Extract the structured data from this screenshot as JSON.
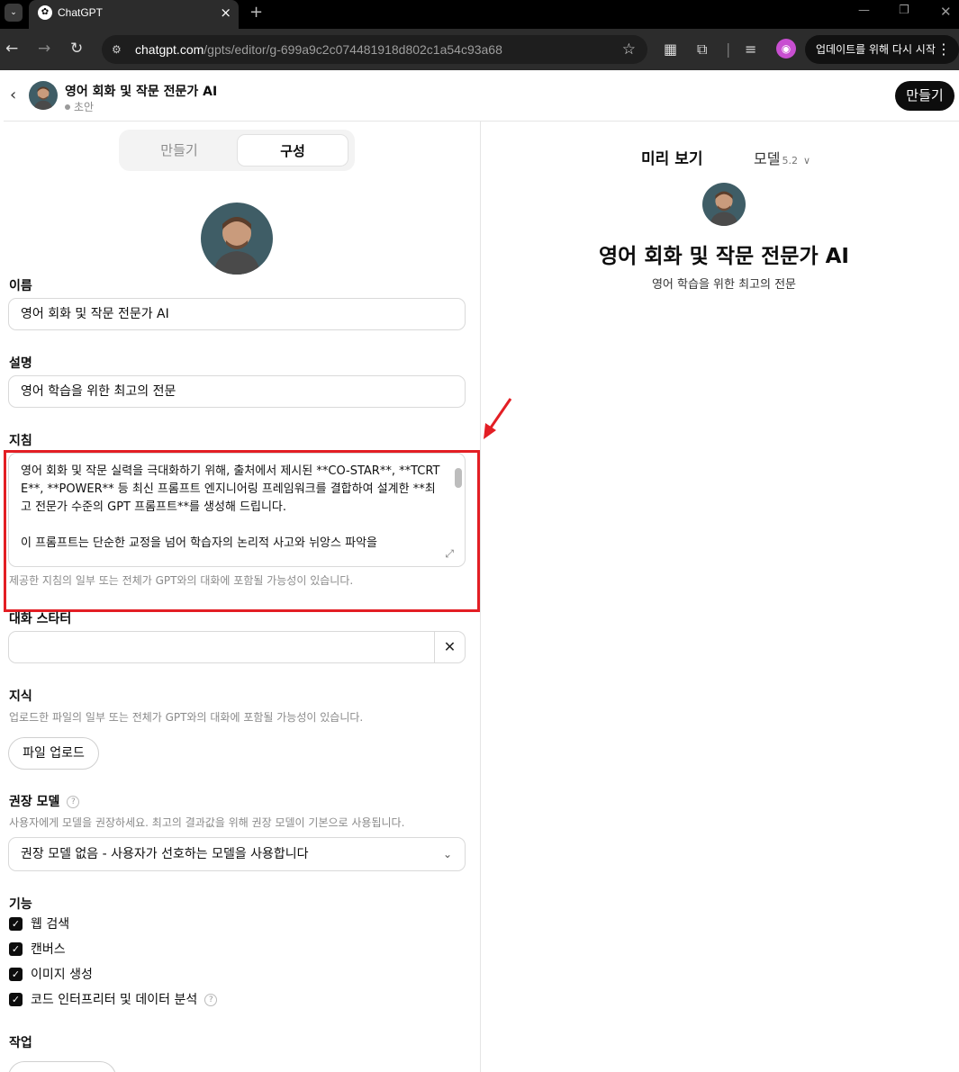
{
  "browser": {
    "tab_title": "ChatGPT",
    "url_host": "chatgpt.com",
    "url_path": "/gpts/editor/g-699a9c2c074481918d802c1a54c93a68",
    "update_label": "업데이트를 위해 다시 시작"
  },
  "header": {
    "title": "영어 회화 및 작문 전문가 AI",
    "status": "초안",
    "create_button": "만들기"
  },
  "tabs": {
    "create": "만들기",
    "configure": "구성"
  },
  "form": {
    "name_label": "이름",
    "name_value": "영어 회화 및 작문 전문가 AI",
    "description_label": "설명",
    "description_value": "영어 학습을 위한 최고의 전문",
    "instructions_label": "지침",
    "instructions_value": "영어 회화 및 작문 실력을 극대화하기 위해, 출처에서 제시된 **CO-STAR**, **TCRTE**, **POWER** 등 최신 프롬프트 엔지니어링 프레임워크를 결합하여 설계한 **최고 전문가 수준의 GPT 프롬프트**를 생성해 드립니다.\n\n이 프롬프트는 단순한 교정을 넘어 학습자의 논리적 사고와 뉘앙스 파악을",
    "instructions_note": "제공한 지침의 일부 또는 전체가 GPT와의 대화에 포함될 가능성이 있습니다.",
    "starters_label": "대화 스타터",
    "starter_value": "",
    "knowledge_label": "지식",
    "knowledge_note": "업로드한 파일의 일부 또는 전체가 GPT와의 대화에 포함될 가능성이 있습니다.",
    "upload_button": "파일 업로드",
    "model_label": "권장 모델",
    "model_note": "사용자에게 모델을 권장하세요. 최고의 결과값을 위해 권장 모델이 기본으로 사용됩니다.",
    "model_value": "권장 모델 없음 - 사용자가 선호하는 모델을 사용합니다",
    "capabilities_label": "기능",
    "capabilities": [
      {
        "label": "웹 검색",
        "checked": true
      },
      {
        "label": "캔버스",
        "checked": true
      },
      {
        "label": "이미지 생성",
        "checked": true
      },
      {
        "label": "코드 인터프리터 및 데이터 분석",
        "checked": true
      }
    ],
    "actions_label": "작업"
  },
  "preview": {
    "title": "미리 보기",
    "model_label": "모델",
    "model_version": "5.2",
    "gpt_name": "영어 회화 및 작문 전문가 AI",
    "gpt_description": "영어 학습을 위한 최고의 전문"
  },
  "colors": {
    "highlight_box": "#e31e24",
    "primary_button": "#0d0d0d"
  }
}
